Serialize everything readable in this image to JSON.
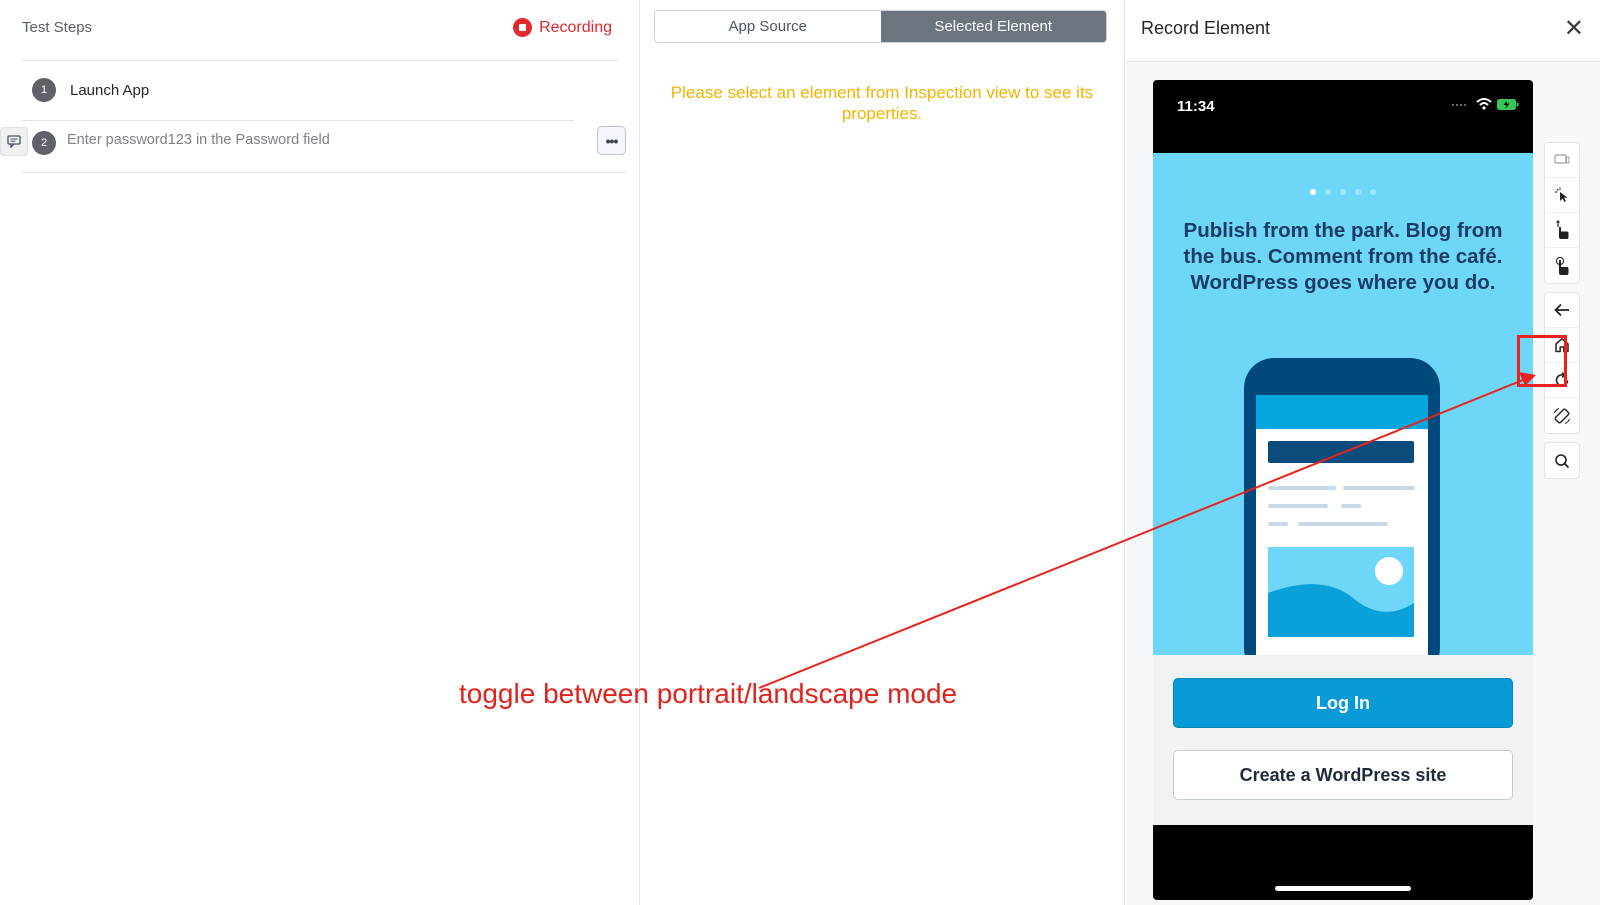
{
  "test_steps": {
    "title": "Test Steps",
    "recording_label": "Recording",
    "steps": [
      {
        "number": "1",
        "label": "Launch App"
      },
      {
        "number": "2",
        "label": "Enter password123 in the Password field"
      }
    ],
    "more_label": "•••"
  },
  "inspector": {
    "tabs": [
      {
        "label": "App Source",
        "active": false
      },
      {
        "label": "Selected Element",
        "active": true
      }
    ],
    "notice": "Please select an element from Inspection view to see its properties."
  },
  "record_element": {
    "title": "Record Element",
    "close_label": "✕",
    "device": {
      "time": "11:34",
      "hero_text": "Publish from the park. Blog from the bus. Comment from the café. WordPress goes where you do.",
      "login_label": "Log In",
      "create_label": "Create a WordPress site"
    },
    "toolbar_icons": [
      "device-icon",
      "pointer-icon",
      "swipe-icon",
      "tap-hold-icon",
      "back-icon",
      "home-icon",
      "refresh-icon",
      "rotate-icon",
      "search-icon"
    ]
  },
  "annotation": {
    "text": "toggle between portrait/landscape mode",
    "color": "#e0231c"
  },
  "colors": {
    "recording": "#e0282e",
    "notice": "#f0b400",
    "active_tab": "#6c757d",
    "login_button": "#079ad6",
    "hero_bg": "#6ed6f8"
  }
}
